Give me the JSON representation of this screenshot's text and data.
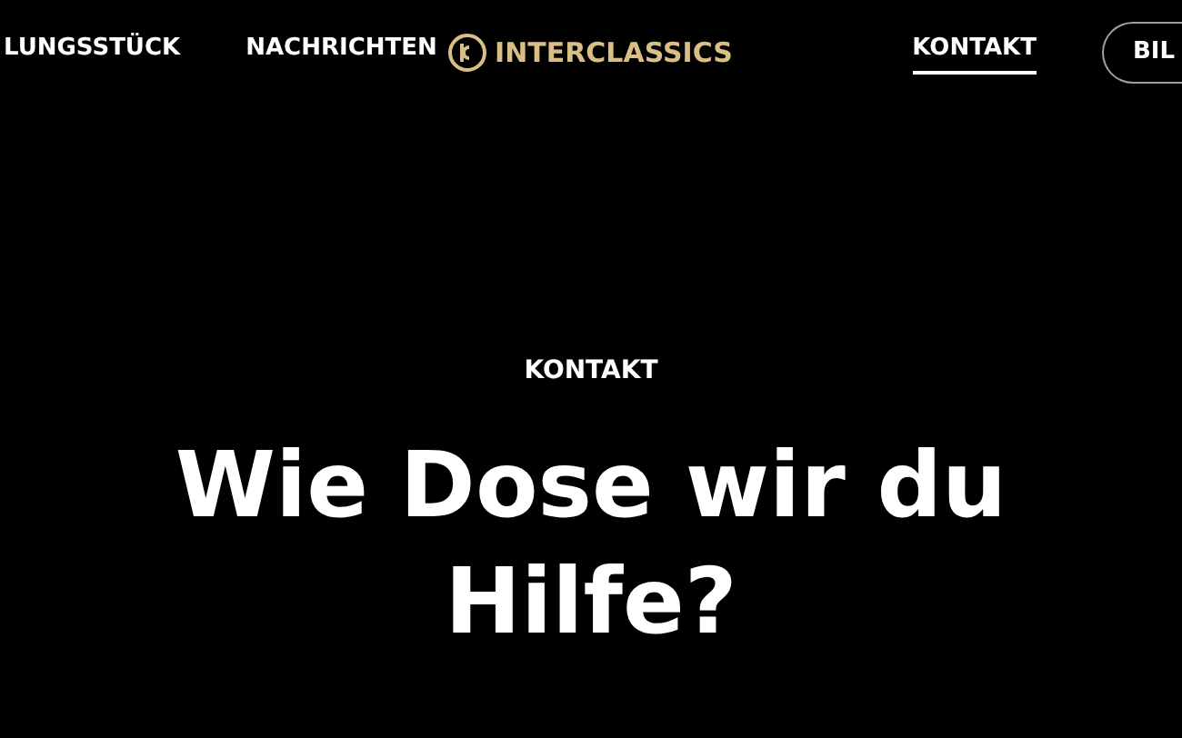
{
  "nav": {
    "items": [
      {
        "label": "LUNGSSTÜCK",
        "selected": false
      },
      {
        "label": "NACHRICHTEN",
        "selected": false
      }
    ],
    "logo": "INTERCLASSICS",
    "right_items": [
      {
        "label": "KONTAKT",
        "selected": true
      }
    ],
    "button": "BIL"
  },
  "hero": {
    "eyebrow": "KONTAKT",
    "heading": "Wie Dose wir du Hilfe?"
  }
}
